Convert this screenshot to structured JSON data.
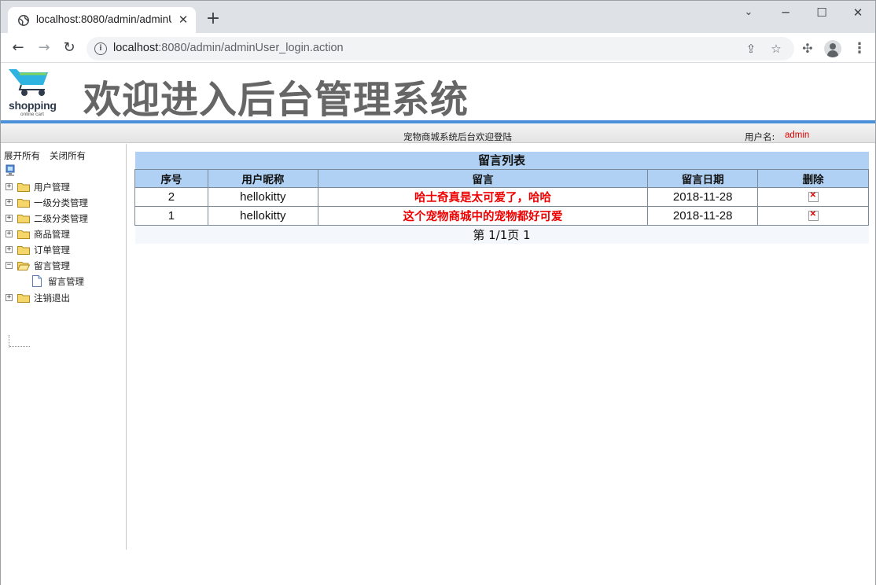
{
  "browser": {
    "tab_title": "localhost:8080/admin/adminU",
    "tab_close": "✕",
    "new_tab": "+",
    "url_host": "localhost",
    "url_rest": ":8080/admin/adminUser_login.action",
    "window_controls": {
      "minimize": "─",
      "maximize": "☐",
      "close": "✕"
    },
    "nav": {
      "back": "←",
      "forward": "→",
      "reload": "↻"
    }
  },
  "header": {
    "logo_word": "shopping",
    "logo_sub": "online cart",
    "title": "欢迎进入后台管理系统"
  },
  "statusbar": {
    "welcome": "宠物商城系统后台欢迎登陆",
    "user_label": "用户名:",
    "user_name": "admin"
  },
  "sidebar": {
    "expand_all": "展开所有",
    "collapse_all": "关闭所有",
    "nodes": [
      {
        "label": "用户管理",
        "toggle": "+"
      },
      {
        "label": "一级分类管理",
        "toggle": "+"
      },
      {
        "label": "二级分类管理",
        "toggle": "+"
      },
      {
        "label": "商品管理",
        "toggle": "+"
      },
      {
        "label": "订单管理",
        "toggle": "+"
      },
      {
        "label": "留言管理",
        "toggle": "−"
      },
      {
        "label": "注销退出",
        "toggle": "+"
      }
    ],
    "child_label": "留言管理"
  },
  "table": {
    "caption": "留言列表",
    "headers": [
      "序号",
      "用户昵称",
      "留言",
      "留言日期",
      "删除"
    ],
    "rows": [
      {
        "id": "2",
        "nickname": "hellokitty",
        "message": "哈士奇真是太可爱了，哈哈",
        "date": "2018-11-28"
      },
      {
        "id": "1",
        "nickname": "hellokitty",
        "message": "这个宠物商城中的宠物都好可爱",
        "date": "2018-11-28"
      }
    ],
    "pager": "第 1/1页 1"
  }
}
